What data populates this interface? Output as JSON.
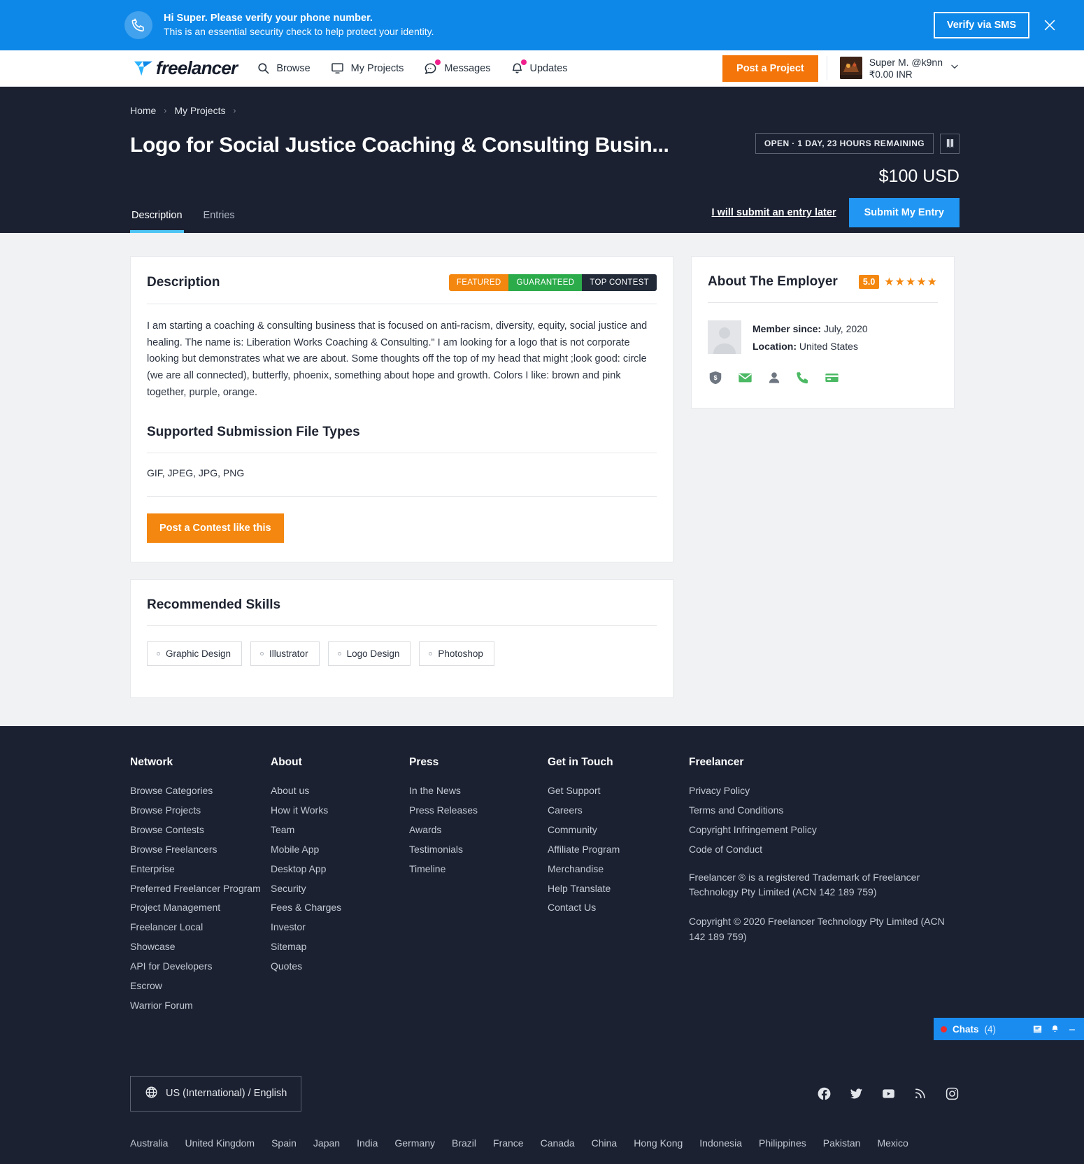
{
  "verify_banner": {
    "icon": "phone-icon",
    "title": "Hi Super. Please verify your phone number.",
    "subtitle": "This is an essential security check to help protect your identity.",
    "button_label": "Verify via SMS",
    "close_icon": "close-icon",
    "bg_color": "#0e88e8"
  },
  "navbar": {
    "logo_text": "freelancer",
    "items": [
      {
        "label": "Browse",
        "icon": "search-icon",
        "badge": false
      },
      {
        "label": "My Projects",
        "icon": "monitor-icon",
        "badge": false
      },
      {
        "label": "Messages",
        "icon": "chat-icon",
        "badge": true
      },
      {
        "label": "Updates",
        "icon": "bell-icon",
        "badge": true
      }
    ],
    "post_project_label": "Post a Project",
    "user": {
      "name": "Super M. @k9nn",
      "balance": "₹0.00 INR",
      "chevron": "chevron-down-icon"
    }
  },
  "project_header": {
    "breadcrumb": [
      "Home",
      "My Projects"
    ],
    "title": "Logo for Social Justice Coaching & Consulting Busin...",
    "status": "OPEN · 1 DAY, 23 HOURS REMAINING",
    "bookmark_icon": "bookmark-icon",
    "price": "$100 USD",
    "tabs": [
      {
        "label": "Description",
        "active": true
      },
      {
        "label": "Entries",
        "active": false
      }
    ],
    "later_link": "I will submit an entry later",
    "submit_label": "Submit My Entry",
    "accent_color": "#4ec5f5"
  },
  "description_card": {
    "title": "Description",
    "badges": [
      {
        "label": "FEATURED",
        "color": "#f4870f"
      },
      {
        "label": "GUARANTEED",
        "color": "#2cab4b"
      },
      {
        "label": "TOP CONTEST",
        "color": "#222a38"
      }
    ],
    "body": "I am starting a coaching & consulting business that is focused on anti-racism, diversity, equity, social justice and healing. The name is: Liberation Works Coaching & Consulting.\" I am looking for a logo that is not corporate looking but demonstrates what we are about. Some thoughts off the top of my head that might ;look good: circle (we are all connected), butterfly, phoenix, something about hope and growth. Colors I like: brown and pink together, purple, orange.",
    "filetypes_title": "Supported Submission File Types",
    "filetypes_value": "GIF, JPEG, JPG, PNG",
    "contest_button": "Post a Contest like this"
  },
  "skills_card": {
    "title": "Recommended Skills",
    "skills": [
      "Graphic Design",
      "Illustrator",
      "Logo Design",
      "Photoshop"
    ]
  },
  "employer_card": {
    "title": "About The Employer",
    "rating_value": "5.0",
    "stars": "★★★★★",
    "avatar": "employer-avatar",
    "member_since_label": "Member since:",
    "member_since_value": "July, 2020",
    "location_label": "Location:",
    "location_value": "United States",
    "verifications": [
      {
        "name": "payment-shield-icon",
        "verified": false
      },
      {
        "name": "email-icon",
        "verified": true
      },
      {
        "name": "profile-icon",
        "verified": false
      },
      {
        "name": "phone-icon",
        "verified": true
      },
      {
        "name": "payment-card-icon",
        "verified": true
      }
    ]
  },
  "footer": {
    "columns": [
      {
        "heading": "Network",
        "links": [
          "Browse Categories",
          "Browse Projects",
          "Browse Contests",
          "Browse Freelancers",
          "Enterprise",
          "Preferred Freelancer Program",
          "Project Management",
          "Freelancer Local",
          "Showcase",
          "API for Developers",
          "Escrow",
          "Warrior Forum"
        ]
      },
      {
        "heading": "About",
        "links": [
          "About us",
          "How it Works",
          "Team",
          "Mobile App",
          "Desktop App",
          "Security",
          "Fees & Charges",
          "Investor",
          "Sitemap",
          "Quotes"
        ]
      },
      {
        "heading": "Press",
        "links": [
          "In the News",
          "Press Releases",
          "Awards",
          "Testimonials",
          "Timeline"
        ]
      },
      {
        "heading": "Get in Touch",
        "links": [
          "Get Support",
          "Careers",
          "Community",
          "Affiliate Program",
          "Merchandise",
          "Help Translate",
          "Contact Us"
        ]
      },
      {
        "heading": "Freelancer",
        "links": [
          "Privacy Policy",
          "Terms and Conditions",
          "Copyright Infringement Policy",
          "Code of Conduct"
        ]
      }
    ],
    "trademark_note": "Freelancer ® is a registered Trademark of Freelancer Technology Pty Limited (ACN 142 189 759)",
    "copyright_note": "Copyright © 2020 Freelancer Technology Pty Limited (ACN 142 189 759)",
    "language_label": "US (International) / English",
    "language_icon": "globe-icon",
    "socials": [
      "facebook-icon",
      "twitter-icon",
      "youtube-icon",
      "rss-icon",
      "instagram-icon"
    ],
    "countries": [
      "Australia",
      "United Kingdom",
      "Spain",
      "Japan",
      "India",
      "Germany",
      "Brazil",
      "France",
      "Canada",
      "China",
      "Hong Kong",
      "Indonesia",
      "Philippines",
      "Pakistan",
      "Mexico"
    ]
  },
  "chatbar": {
    "label": "Chats",
    "count": "(4)",
    "icons": [
      "inbox-icon",
      "bell-icon",
      "minimize-icon"
    ]
  }
}
